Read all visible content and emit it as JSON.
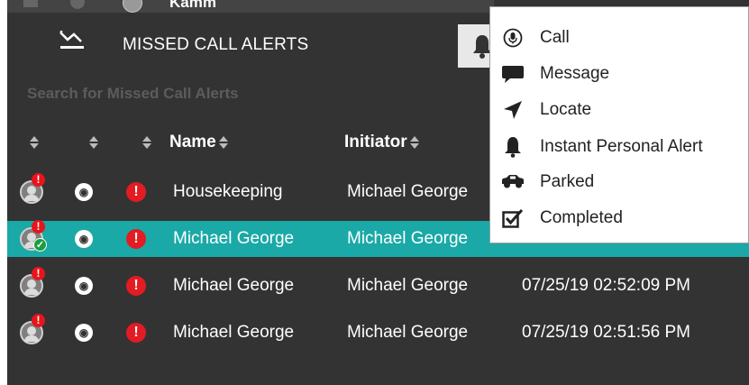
{
  "header": {
    "peek_name": "Kamm",
    "title": "MISSED CALL ALERTS"
  },
  "search": {
    "placeholder": "Search for Missed Call Alerts"
  },
  "columns": {
    "name": "Name",
    "initiator": "Initiator"
  },
  "rows": [
    {
      "name": "Housekeeping",
      "initiator": "Michael George",
      "time": "",
      "selected": false,
      "completed": false
    },
    {
      "name": "Michael George",
      "initiator": "Michael George",
      "time": "",
      "selected": true,
      "completed": true
    },
    {
      "name": "Michael George",
      "initiator": "Michael George",
      "time": "07/25/19 02:52:09 PM",
      "selected": false,
      "completed": false
    },
    {
      "name": "Michael George",
      "initiator": "Michael George",
      "time": "07/25/19 02:51:56 PM",
      "selected": false,
      "completed": false
    }
  ],
  "context_menu": {
    "items": [
      {
        "label": "Call",
        "icon": "microphone-icon"
      },
      {
        "label": "Message",
        "icon": "speech-bubble-icon"
      },
      {
        "label": "Locate",
        "icon": "location-arrow-icon"
      },
      {
        "label": "Instant Personal Alert",
        "icon": "bell-icon"
      },
      {
        "label": "Parked",
        "icon": "car-icon"
      },
      {
        "label": "Completed",
        "icon": "checkbox-icon"
      }
    ]
  },
  "colors": {
    "panel_bg": "#333333",
    "selected_row": "#1aa9a6",
    "alert_red": "#e31b23",
    "completed_green": "#1a9e3d"
  }
}
